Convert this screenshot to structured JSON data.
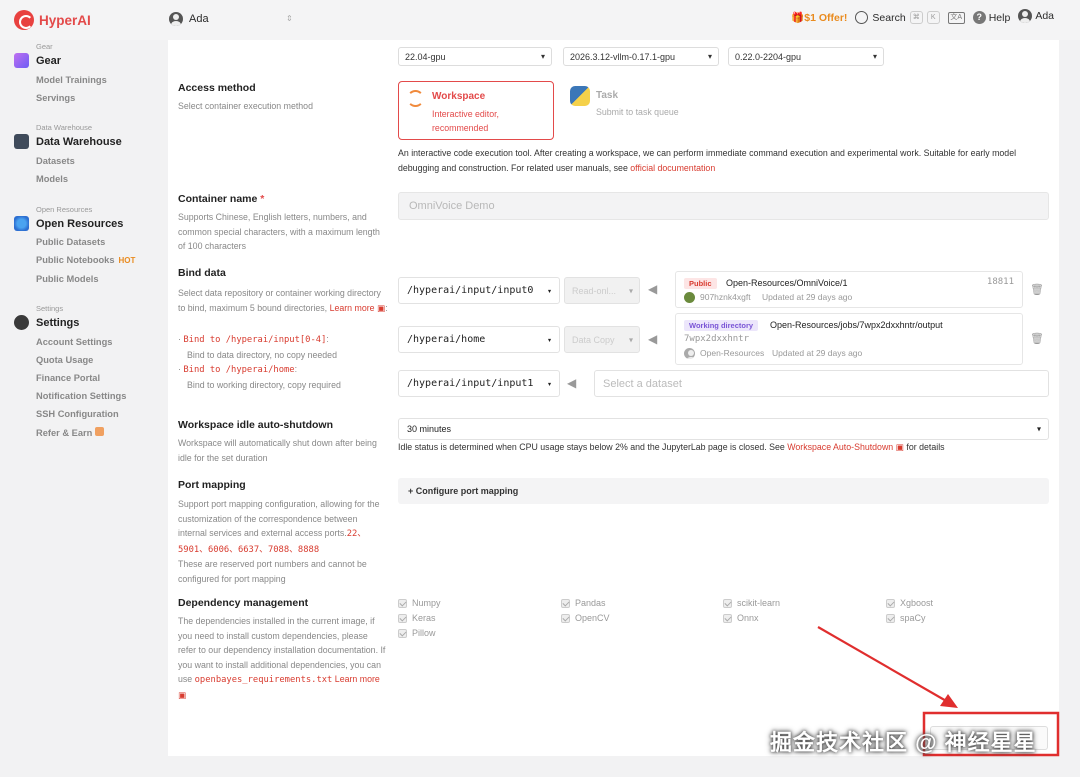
{
  "topbar": {
    "brand": "HyperAI",
    "workspace_user": "Ada",
    "offer": "$1 Offer!",
    "search_label": "Search",
    "kbd_cmd": "⌘",
    "kbd_k": "K",
    "lang_icon": "文A",
    "help_label": "Help",
    "user_label": "Ada"
  },
  "sidebar": {
    "gear": {
      "caption": "Gear",
      "title": "Gear",
      "items": [
        "Model Trainings",
        "Servings"
      ]
    },
    "data_warehouse": {
      "caption": "Data Warehouse",
      "title": "Data Warehouse",
      "items": [
        "Datasets",
        "Models"
      ]
    },
    "open_resources": {
      "caption": "Open Resources",
      "title": "Open Resources",
      "items": [
        "Public Datasets",
        "Public Notebooks",
        "Public Models"
      ],
      "hot": "HOT"
    },
    "settings": {
      "caption": "Settings",
      "title": "Settings",
      "items": [
        "Account Settings",
        "Quota Usage",
        "Finance Portal",
        "Notification Settings",
        "SSH Configuration",
        "Refer & Earn"
      ]
    }
  },
  "images": {
    "sel1": "22.04-gpu",
    "sel2": "2026.3.12-vllm-0.17.1-gpu",
    "sel3": "0.22.0-2204-gpu"
  },
  "access": {
    "label": "Access method",
    "desc": "Select container execution method",
    "workspace_title": "Workspace",
    "workspace_sub": "Interactive editor, recommended",
    "task_title": "Task",
    "task_sub": "Submit to task queue",
    "note": "An interactive code execution tool. After creating a workspace, we can perform immediate command execution and experimental work. Suitable for early model debugging and construction. For related user manuals, see ",
    "note_link": "official documentation"
  },
  "container": {
    "label": "Container name",
    "required": "*",
    "desc": "Supports Chinese, English letters, numbers, and common special characters, with a maximum length of 100 characters",
    "value": "OmniVoice Demo"
  },
  "bind": {
    "label": "Bind data",
    "desc": "Select data repository or container working directory to bind, maximum 5 bound directories, ",
    "learn_more": "Learn more",
    "learn_more_suffix": ":",
    "hint1_code": "Bind to /hyperai/input[0-4]",
    "hint1_colon": ":",
    "hint1_text": "Bind to data directory, no copy needed",
    "hint2_code": "Bind to /hyperai/home",
    "hint2_colon": ":",
    "hint2_text": "Bind to working directory, copy required",
    "rows": [
      {
        "path": "/hyperai/input/input0",
        "mode": "Read-onl...",
        "tag": "Public",
        "name": "Open-Resources/OmniVoice/1",
        "id": "18811",
        "owner": "907hznk4xgft",
        "updated": "Updated at 29 days ago"
      },
      {
        "path": "/hyperai/home",
        "mode": "Data Copy",
        "tag": "Working directory",
        "name": "Open-Resources/jobs/7wpx2dxxhntr/output",
        "id": "7wpx2dxxhntr",
        "owner": "Open-Resources",
        "updated": "Updated at 29 days ago"
      },
      {
        "path": "/hyperai/input/input1",
        "placeholder": "Select a dataset"
      }
    ]
  },
  "idle": {
    "label": "Workspace idle auto-shutdown",
    "desc": "Workspace will automatically shut down after being idle for the set duration",
    "value": "30 minutes",
    "note": "Idle status is determined when CPU usage stays below 2% and the JupyterLab page is closed. See ",
    "note_link": "Workspace Auto-Shutdown",
    "note_tail": " for details"
  },
  "port": {
    "label": "Port mapping",
    "desc": "Support port mapping configuration, allowing for the customization of the correspondence between internal services and external access ports.",
    "ports": "22、5901、6006、6637、7088、8888",
    "desc2": "These are reserved port numbers and cannot be configured for port mapping",
    "button": "+ Configure port mapping"
  },
  "deps": {
    "label": "Dependency management",
    "desc": "The dependencies installed in the current image, if you need to install custom dependencies, please refer to our dependency installation documentation. If you want to install additional dependencies, you can use ",
    "code": "openbayes_requirements.txt",
    "learn_more": "Learn more",
    "col1": [
      "Numpy",
      "Keras",
      "Pillow"
    ],
    "col2": [
      "Pandas",
      "OpenCV"
    ],
    "col3": [
      "scikit-learn",
      "Onnx"
    ],
    "col4": [
      "Xgboost",
      "spaCy"
    ]
  },
  "watermark": "掘金技术社区 @ 神经星星",
  "colors": {
    "accent": "#e34a4a",
    "highlight": "#e02e2e",
    "offer": "#e98b1f"
  }
}
